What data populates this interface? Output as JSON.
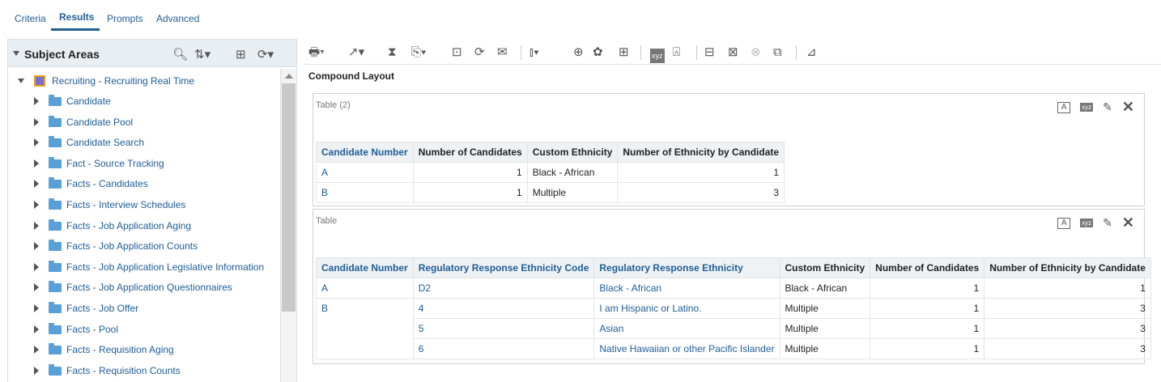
{
  "tabs": [
    "Criteria",
    "Results",
    "Prompts",
    "Advanced"
  ],
  "subject_areas": {
    "title": "Subject Areas",
    "root": "Recruiting - Recruiting Real Time",
    "items": [
      "Candidate",
      "Candidate Pool",
      "Candidate Search",
      "Fact - Source Tracking",
      "Facts - Candidates",
      "Facts - Interview Schedules",
      "Facts - Job Application Aging",
      "Facts - Job Application Counts",
      "Facts - Job Application Legislative Information",
      "Facts - Job Application Questionnaires",
      "Facts - Job Offer",
      "Facts - Pool",
      "Facts - Requisition Aging",
      "Facts - Requisition Counts"
    ]
  },
  "compound_layout": "Compound Layout",
  "table1": {
    "title": "Table (2)",
    "headers": [
      "Candidate Number",
      "Number of Candidates",
      "Custom Ethnicity",
      "Number of Ethnicity by Candidate"
    ],
    "rows": [
      [
        "A",
        "1",
        "Black - African",
        "1"
      ],
      [
        "B",
        "1",
        "Multiple",
        "3"
      ]
    ]
  },
  "table2": {
    "title": "Table",
    "headers": [
      "Candidate Number",
      "Regulatory Response Ethnicity Code",
      "Regulatory Response Ethnicity",
      "Custom Ethnicity",
      "Number of Candidates",
      "Number of Ethnicity by Candidate"
    ],
    "rows": [
      [
        "A",
        "D2",
        "Black - African",
        "Black - African",
        "1",
        "1"
      ],
      [
        "B",
        "4",
        "I am Hispanic or Latino.",
        "Multiple",
        "1",
        "3"
      ],
      [
        "",
        "5",
        "Asian",
        "Multiple",
        "1",
        "3"
      ],
      [
        "",
        "6",
        "Native Hawaiian or other Pacific Islander",
        "Multiple",
        "1",
        "3"
      ]
    ]
  },
  "view_tools": {
    "format_text": "A",
    "xyz": "xyz",
    "edit": "✎",
    "remove": "✕"
  },
  "colors": {
    "link": "#1f5d96",
    "header_bg": "#eef2f5",
    "panel_header_bg": "#e8eef2"
  }
}
